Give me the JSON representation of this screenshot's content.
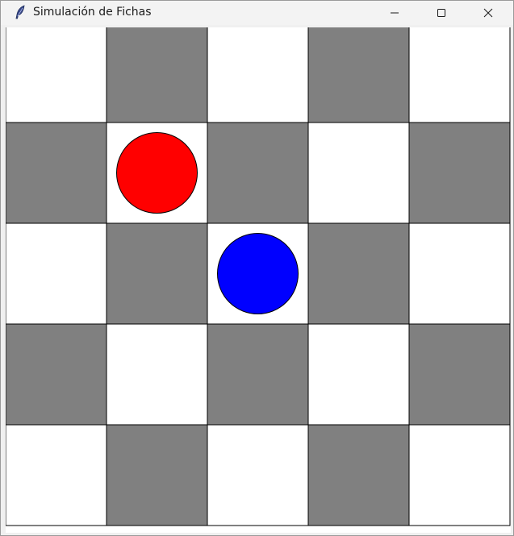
{
  "window": {
    "title": "Simulación de Fichas",
    "app_icon": "feather-icon",
    "controls": {
      "minimize_icon": "minimize-icon",
      "maximize_icon": "maximize-icon",
      "close_icon": "close-icon"
    }
  },
  "board": {
    "rows": 5,
    "cols": 5,
    "light_color": "#ffffff",
    "dark_color": "#808080",
    "pattern_note": "dark squares where (row + col) is odd",
    "pieces": [
      {
        "name": "red-piece",
        "row": 1,
        "col": 1,
        "color": "#ff0000"
      },
      {
        "name": "blue-piece",
        "row": 2,
        "col": 2,
        "color": "#0000ff"
      }
    ]
  }
}
